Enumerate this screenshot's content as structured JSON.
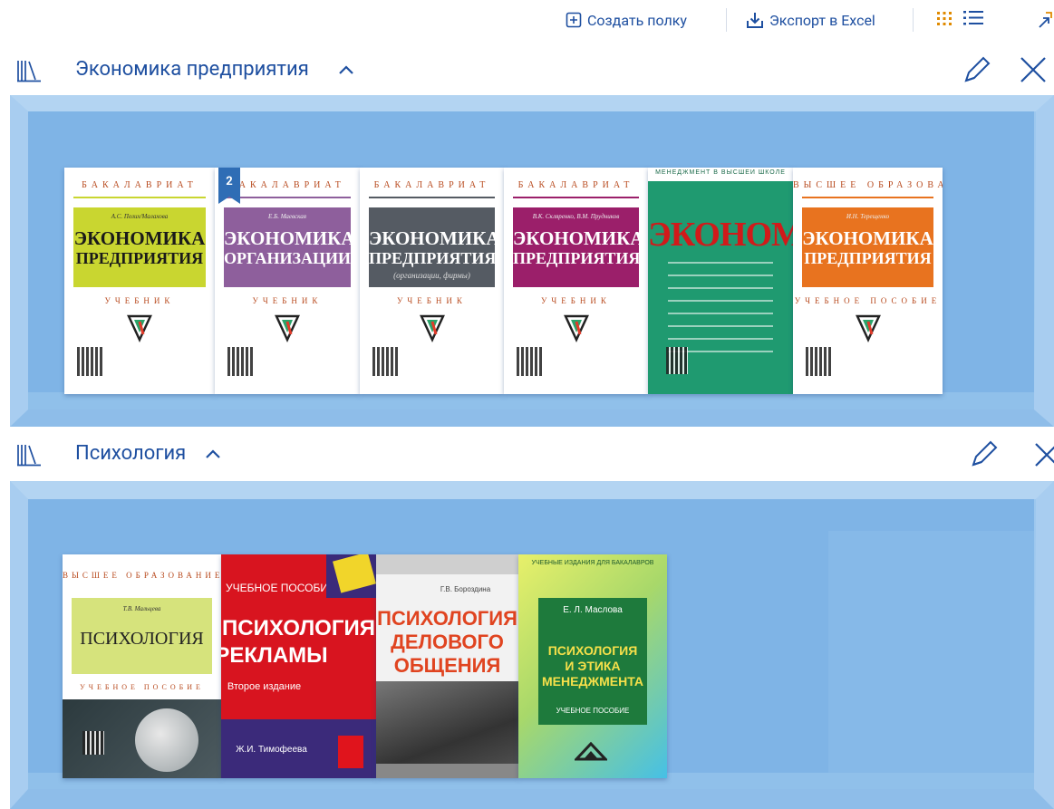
{
  "toolbar": {
    "create_shelf_label": "Создать полку",
    "export_label": "Экспорт в Excel",
    "colors": {
      "accent": "#1e4fa0",
      "grid_icon": "#e08a00"
    }
  },
  "shelves": [
    {
      "title": "Экономика предприятия",
      "books": [
        {
          "series": "БАКАЛАВРИАТ",
          "author": "А.С. Пелих/Малахова",
          "title1": "ЭКОНОМИКА",
          "title2": "ПРЕДПРИЯТИЯ",
          "type": "УЧЕБНИК",
          "bg": "#ffffff",
          "band": "#c9d630",
          "text": "#1a1a1a"
        },
        {
          "badge": "2",
          "series": "БАКАЛАВРИАТ",
          "author": "Е.Б. Маевская",
          "title1": "ЭКОНОМИКА",
          "title2": "ОРГАНИЗАЦИИ",
          "type": "УЧЕБНИК",
          "bg": "#ffffff",
          "band": "#8e5f9c",
          "text": "#ffffff"
        },
        {
          "series": "БАКАЛАВРИАТ",
          "author": "",
          "title1": "ЭКОНОМИКА",
          "title2": "ПРЕДПРИЯТИЯ",
          "subtitle": "(организации, фирмы)",
          "type": "УЧЕБНИК",
          "bg": "#ffffff",
          "band": "#555b63",
          "text": "#ffffff"
        },
        {
          "series": "БАКАЛАВРИАТ",
          "author": "В.К. Скляренко, В.М. Прудников",
          "title1": "ЭКОНОМИКА",
          "title2": "ПРЕДПРИЯТИЯ",
          "type": "УЧЕБНИК",
          "bg": "#ffffff",
          "band": "#9b1f6a",
          "text": "#ffffff"
        },
        {
          "series": "МЕНЕДЖМЕНТ В ВЫСШЕЙ ШКОЛЕ",
          "title1": "ЭКОНОМИКА",
          "bg": "#1c8f6a",
          "band": "#1c8f6a",
          "text": "#d11a1a"
        },
        {
          "series": "ВЫСШЕЕ ОБРАЗОВАНИЕ",
          "author": "И.Н. Терещенко",
          "title1": "ЭКОНОМИКА",
          "title2": "ПРЕДПРИЯТИЯ",
          "type": "УЧЕБНОЕ ПОСОБИЕ",
          "bg": "#ffffff",
          "band": "#e8731f",
          "text": "#ffffff"
        }
      ]
    },
    {
      "title": "Психология",
      "books": [
        {
          "series": "ВЫСШЕЕ ОБРАЗОВАНИЕ",
          "author": "Т.В. Мальцева",
          "title1": "ПСИХОЛОГИЯ",
          "type": "УЧЕБНОЕ ПОСОБИЕ",
          "bg": "#ffffff",
          "band": "#d6e37c",
          "text": "#1a1a1a"
        },
        {
          "series": "УЧЕБНОЕ ПОСОБИЕ",
          "title1": "ПСИХОЛОГИЯ",
          "title2": "РЕКЛАМЫ",
          "edition": "Второе издание",
          "author": "Ж.И. Тимофеева",
          "bg": "#d8141f",
          "band": "#3b2a7a",
          "text": "#ffffff"
        },
        {
          "author": "Г.В. Бороздина",
          "title1": "ПСИХОЛОГИЯ",
          "title2": "ДЕЛОВОГО",
          "title3": "ОБЩЕНИЯ",
          "bg": "#f2f2f2",
          "band": "#e04420",
          "text": "#e04420"
        },
        {
          "series": "УЧЕБНЫЕ ИЗДАНИЯ ДЛЯ БАКАЛАВРОВ",
          "author": "Е. Л. Маслова",
          "title1": "ПСИХОЛОГИЯ",
          "title2": "И ЭТИКА",
          "title3": "МЕНЕДЖМЕНТА",
          "type": "УЧЕБНОЕ ПОСОБИЕ",
          "bg": "#c8e66a",
          "band": "#1e7a3c",
          "text": "#f6e04a"
        }
      ]
    }
  ]
}
